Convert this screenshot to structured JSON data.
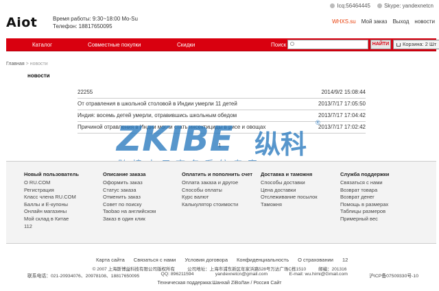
{
  "header": {
    "logo": "Aiot",
    "hours": "Время работы: 9:30~18:00 Mo-Su",
    "phone": "Телефон: 18817650095",
    "icq": "Icq:56464445",
    "skype": "Skype: yandexnetcn",
    "user_links": [
      "WHXS.su",
      "Мой заказ",
      "Выход",
      "новости"
    ]
  },
  "nav": {
    "items": [
      "Каталог",
      "Совместные покупки",
      "Скидки"
    ],
    "search_label": "Поиск",
    "search_placeholder": "",
    "search_button": "НАЙТИ",
    "cart": "Корзина: 2 Шт"
  },
  "breadcrumb": {
    "home": "Главная",
    "sep": ">",
    "current": "новости"
  },
  "page_title": "новости",
  "news": [
    {
      "title": "22255",
      "date": "2014/9/2 15:08:44"
    },
    {
      "title": "От отравления в школьной столовой в Индии умерли 11 детей",
      "date": "2013/7/17 17:05:50"
    },
    {
      "title": "Индия: восемь детей умерли, отравившись школьным обедом",
      "date": "2013/7/17 17:04:42"
    },
    {
      "title": "Причиной отравления в Индии могли стать инсектициды в рисе и овощах",
      "date": "2013/7/17 17:02:42"
    }
  ],
  "pager": "1",
  "watermark": {
    "latin": "ZKIBE",
    "cjk": "纵科",
    "reg": "®",
    "sub": "跨境电子商务系统专家"
  },
  "footer_cols": [
    {
      "heading": "Новый пользователь",
      "links": [
        "О RU.COM",
        "Регистрация",
        "Класс члена RU.COM",
        "Баллы и Е-купоны",
        "Онлайн магазины",
        "Мой склад в Китае",
        "112"
      ]
    },
    {
      "heading": "Описание заказа",
      "links": [
        "Оформить заказ",
        "Статус заказа",
        "Отменить заказ",
        "Совет по поиску",
        "Taobao на английском",
        "Заказ в один клик"
      ]
    },
    {
      "heading": "Оплатить и пополнить счет",
      "links": [
        "Оплата заказа и другое",
        "Способы оплаты",
        "Курс валют",
        "Калькулятор стоимости"
      ]
    },
    {
      "heading": "Доставка и таможня",
      "links": [
        "Способы доставки",
        "Цена доставки",
        "Отслеживание посылок",
        "Таможня"
      ]
    },
    {
      "heading": "Служба поддержки",
      "links": [
        "Связаться с нами",
        "Возврат товара",
        "Возврат денег",
        "Помощь в размерах",
        "Таблицы размеров",
        "Примерный вес"
      ]
    }
  ],
  "footer": {
    "links": [
      "Карта сайта",
      "Связаться с нами",
      "Условия договора",
      "Конфиденциальность",
      "О страховании",
      "12"
    ],
    "line1": "© 2007 上海斯博益科技有限公司版权所有          公司地址：上海市浦东新区年家浜路528号万达广场C栋1510          邮编：201316",
    "line2": [
      "联系电话：021-20934076、20978108、18817650095",
      "QQ: 896211594",
      "yandexnetcn@gmail.com",
      "E-mail: wu.himi@Gmail.com",
      "沪ICP备07509330号-10"
    ],
    "line3": "Техническая поддержка:Шанхай ZiBoЛан / Россия Сайт"
  }
}
